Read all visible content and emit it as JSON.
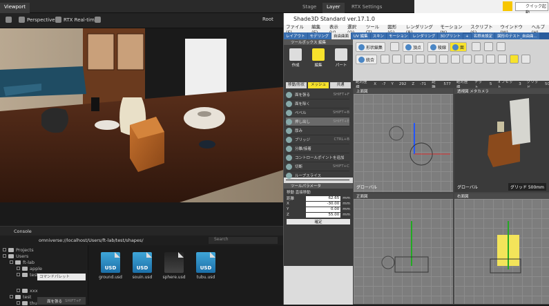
{
  "top_tabs": {
    "viewport": "Viewport",
    "stage": "Stage",
    "layer": "Layer",
    "rtx": "RTX Settings"
  },
  "os": {
    "quick": "クイック起動"
  },
  "viewport_toolbar": {
    "perspective": "Perspective",
    "render_mode": "RTX Real-time",
    "root": "Root"
  },
  "content": {
    "tab": "Console",
    "path": "omniverse://localhost/Users/ft-lab/test/shapes/",
    "search_placeholder": "Search",
    "tree": [
      {
        "label": "Projects"
      },
      {
        "label": "Users"
      },
      {
        "label": "ft-lab"
      },
      {
        "label": "apple"
      },
      {
        "label": "test"
      },
      {
        "label": "xxx"
      },
      {
        "label": "test"
      },
      {
        "label": "thumbs"
      }
    ],
    "popup": {
      "label": "コマンドパレット",
      "button": "面を張る",
      "shortcut": "SHIFT+F"
    },
    "files": [
      {
        "name": "ground.usd",
        "badge": "USD"
      },
      {
        "name": "souin.usd",
        "badge": "USD"
      },
      {
        "name": "sphere.usd",
        "badge": ""
      },
      {
        "name": "tubu.usd",
        "badge": "USD"
      }
    ]
  },
  "shade": {
    "title": "Shade3D Standard ver.17.1.0",
    "menu": [
      "ファイル(F)",
      "編集(E)",
      "表示(V)",
      "選択(O)",
      "ツール(T)",
      "図形(G)",
      "レンダリング(R)",
      "モーション(N)",
      "スクリプト(S)",
      "ウインドウ(W)",
      "ヘルプ(H)"
    ],
    "tabs": [
      "レイアウト",
      "モデリング",
      "自由曲面",
      "UV 編集",
      "スキン",
      "モーション",
      "レンダリング",
      "3Dプリント",
      "+",
      "名称未設定",
      "図形のテスト_自由曲..."
    ],
    "toolbox": {
      "title": "ツールボックス 編集",
      "big": [
        "作成",
        "編集",
        "パート"
      ],
      "sub": [
        "移動/形状",
        "メッシュ",
        "共通"
      ],
      "items": [
        "面を張る",
        "面を除く",
        "ベベル",
        "押し出し",
        "厚み",
        "ブリッジ",
        "分離/接着",
        "コントロールポイントを追加",
        "切断",
        "ループスライス"
      ],
      "shortcuts": [
        "SHIFT+F",
        "",
        "SHIFT+B",
        "SHIFT+E",
        "",
        "CTRL+B",
        "",
        "",
        "SHIFT+C",
        ""
      ]
    },
    "params": {
      "title": "ツールパラメータ",
      "sub": "移動 直接移動",
      "rows": [
        {
          "k": "距離",
          "v": "62.65",
          "u": "mm"
        },
        {
          "k": "X",
          "v": "-30.00",
          "u": "mm"
        },
        {
          "k": "Y",
          "v": "0.00",
          "u": "mm"
        },
        {
          "k": "Z",
          "v": "55.00",
          "u": "mm"
        }
      ],
      "confirm": "確定"
    },
    "ribbon": {
      "shape_edit": "形状編集",
      "vertex": "頂点",
      "edge": "稜線",
      "face": "面",
      "merge": "統合"
    },
    "coords": [
      "絶対座標",
      "X",
      "-7",
      "Y",
      "292",
      "Z",
      "-71",
      "距離",
      "577"
    ],
    "coords2": [
      "絶対座標",
      "ナット",
      "5",
      "オフセット",
      "3",
      "グリッド",
      "50"
    ],
    "views": {
      "top": "上面図",
      "persp": "透視図 メタカメラ",
      "front": "正面図",
      "right": "右面図",
      "global": "グローバル",
      "grid": "グリッド 500mm"
    }
  }
}
